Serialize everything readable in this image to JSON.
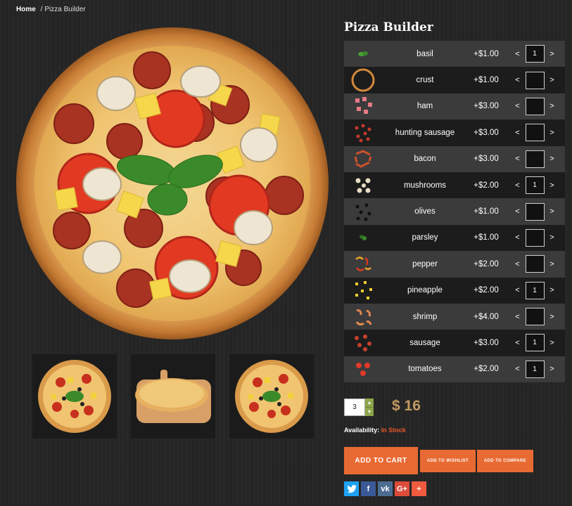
{
  "breadcrumb": {
    "home": "Home",
    "separator": "/",
    "current": "Pizza Builder"
  },
  "product": {
    "title": "Pizza Builder",
    "price": "$ 16",
    "quantity": "3",
    "availability_label": "Availability:",
    "availability_value": "In Stock"
  },
  "ingredients": [
    {
      "name": "basil",
      "price": "+$1.00",
      "qty": "1",
      "icon": "basil-leaf-icon"
    },
    {
      "name": "crust",
      "price": "+$1.00",
      "qty": "",
      "icon": "crust-ring-icon"
    },
    {
      "name": "ham",
      "price": "+$3.00",
      "qty": "",
      "icon": "ham-pieces-icon"
    },
    {
      "name": "hunting sausage",
      "price": "+$3.00",
      "qty": "",
      "icon": "hunting-sausage-pieces-icon"
    },
    {
      "name": "bacon",
      "price": "+$3.00",
      "qty": "",
      "icon": "bacon-strips-icon"
    },
    {
      "name": "mushrooms",
      "price": "+$2.00",
      "qty": "1",
      "icon": "mushroom-pieces-icon"
    },
    {
      "name": "olives",
      "price": "+$1.00",
      "qty": "",
      "icon": "olive-pieces-icon"
    },
    {
      "name": "parsley",
      "price": "+$1.00",
      "qty": "",
      "icon": "parsley-icon"
    },
    {
      "name": "pepper",
      "price": "+$2.00",
      "qty": "",
      "icon": "pepper-pieces-icon"
    },
    {
      "name": "pineapple",
      "price": "+$2.00",
      "qty": "1",
      "icon": "pineapple-pieces-icon"
    },
    {
      "name": "shrimp",
      "price": "+$4.00",
      "qty": "",
      "icon": "shrimp-icon"
    },
    {
      "name": "sausage",
      "price": "+$3.00",
      "qty": "1",
      "icon": "sausage-pieces-icon"
    },
    {
      "name": "tomatoes",
      "price": "+$2.00",
      "qty": "1",
      "icon": "tomato-slices-icon"
    }
  ],
  "qty_controls": {
    "decrease": "<",
    "increase": ">"
  },
  "buttons": {
    "add_to_cart": "ADD TO CART",
    "add_to_wishlist": "ADD TO WISHLIST",
    "add_to_compare": "ADD TO COMPARE"
  },
  "social": [
    {
      "label": "",
      "icon": "twitter-icon",
      "color": "#1da1f2"
    },
    {
      "label": "f",
      "icon": "facebook-icon",
      "color": "#3b5998"
    },
    {
      "label": "vk",
      "icon": "vk-icon",
      "color": "#4c6c91"
    },
    {
      "label": "G+",
      "icon": "google-plus-icon",
      "color": "#dd4b39"
    },
    {
      "label": "+",
      "icon": "share-plus-icon",
      "color": "#f05a3e"
    }
  ],
  "colors": {
    "accent": "#e86a33",
    "price": "#c39a63",
    "stock": "#e8582a",
    "stepper": "#8da64a"
  }
}
